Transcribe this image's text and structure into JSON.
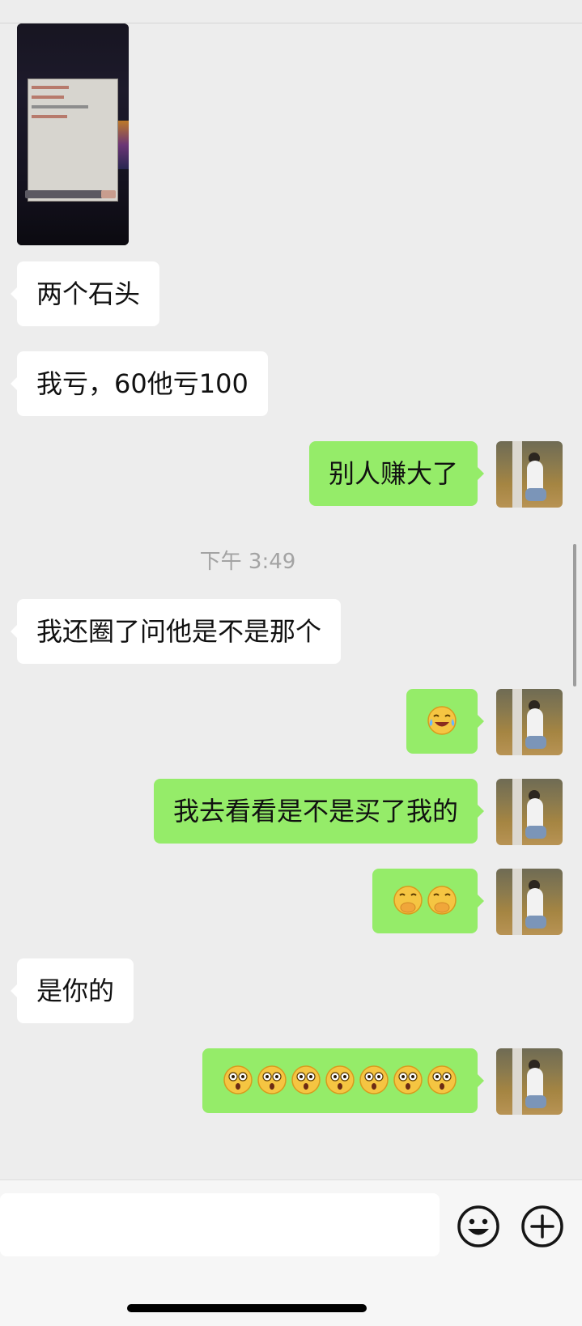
{
  "header": {
    "title": ""
  },
  "chat": {
    "messages": [
      {
        "type": "image",
        "side": "left"
      },
      {
        "type": "text",
        "side": "left",
        "text": "两个石头"
      },
      {
        "type": "text",
        "side": "left",
        "text": "我亏，60他亏100"
      },
      {
        "type": "text",
        "side": "right",
        "text": "别人赚大了"
      },
      {
        "type": "time",
        "text": "下午 3:49"
      },
      {
        "type": "text",
        "side": "left",
        "text": "我还圈了问他是不是那个"
      },
      {
        "type": "emoji",
        "side": "right",
        "emoji": [
          "face-with-tears-of-joy"
        ]
      },
      {
        "type": "text",
        "side": "right",
        "text": "我去看看是不是买了我的"
      },
      {
        "type": "emoji",
        "side": "right",
        "emoji": [
          "face-with-hand-over-mouth",
          "face-with-hand-over-mouth"
        ]
      },
      {
        "type": "text",
        "side": "left",
        "text": "是你的"
      },
      {
        "type": "emoji",
        "side": "right",
        "emoji": [
          "astonished-face",
          "astonished-face",
          "astonished-face",
          "astonished-face",
          "astonished-face",
          "astonished-face",
          "astonished-face"
        ]
      }
    ]
  },
  "input_bar": {
    "icons": {
      "emoji": "smiley-icon",
      "more": "plus-circle-icon"
    }
  },
  "colors": {
    "background": "#ededed",
    "left_bubble": "#ffffff",
    "right_bubble": "#95ec69",
    "timestamp": "#a3a3a3"
  }
}
